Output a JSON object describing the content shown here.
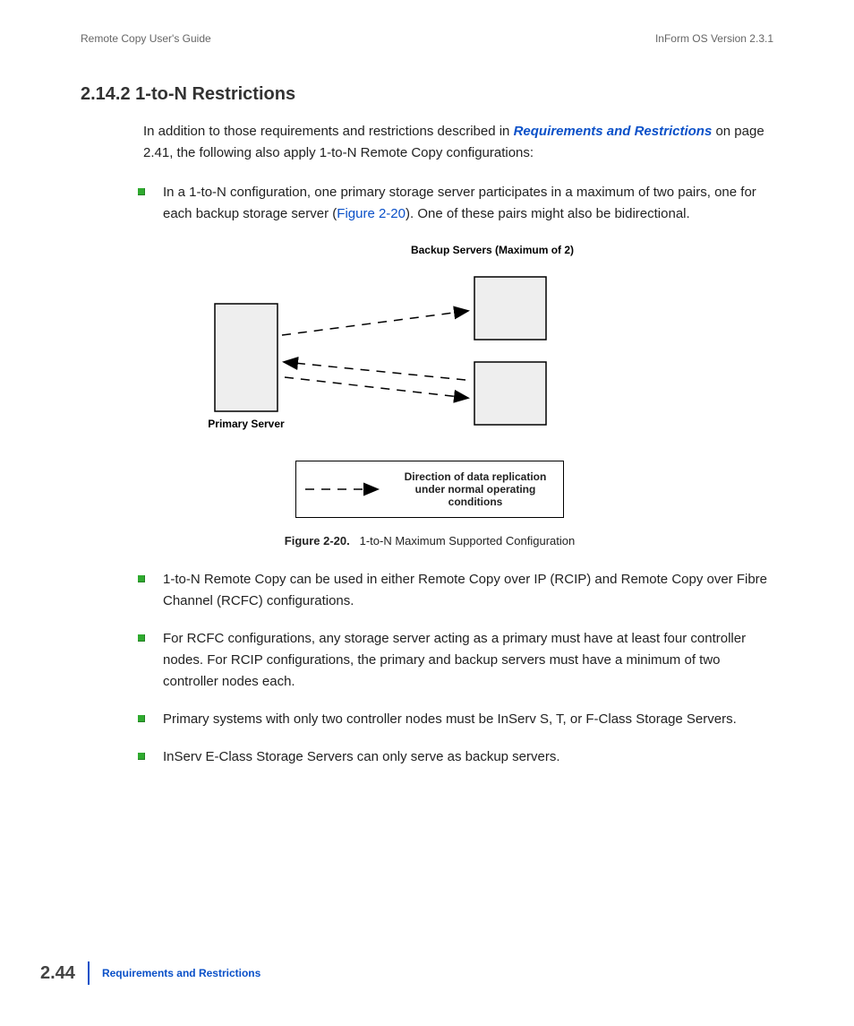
{
  "header": {
    "left": "Remote Copy User's Guide",
    "right": "InForm OS Version 2.3.1"
  },
  "section": {
    "number": "2.14.2",
    "title": "1-to-N Restrictions"
  },
  "intro": {
    "pre": "In addition to those requirements and restrictions described in ",
    "link": "Requirements and Restrictions",
    "post": " on page 2.41, the following also apply 1-to-N Remote Copy configurations:"
  },
  "bullet1": {
    "pre": "In a 1-to-N configuration, one primary storage server participates in a maximum of two pairs, one for each backup storage server (",
    "figref": "Figure 2-20",
    "post": "). One of these pairs might also be bidirectional."
  },
  "diagram": {
    "backup_label": "Backup Servers (Maximum of 2)",
    "primary_label": "Primary Server",
    "legend": "Direction of data replication under normal operating conditions"
  },
  "figure": {
    "label": "Figure 2-20.",
    "caption": "1-to-N Maximum Supported Configuration"
  },
  "bullets_rest": [
    "1-to-N Remote Copy can be used in either Remote Copy over IP (RCIP) and Remote Copy over Fibre Channel (RCFC) configurations.",
    "For RCFC configurations, any storage server acting as a primary must have at least four controller nodes. For RCIP configurations, the primary and backup servers must have a minimum of two controller nodes each.",
    "Primary systems with only two controller nodes must be InServ S, T, or F-Class Storage Servers.",
    "InServ E-Class Storage Servers can only serve as backup servers."
  ],
  "footer": {
    "page": "2.44",
    "chapter": "Requirements and Restrictions"
  }
}
